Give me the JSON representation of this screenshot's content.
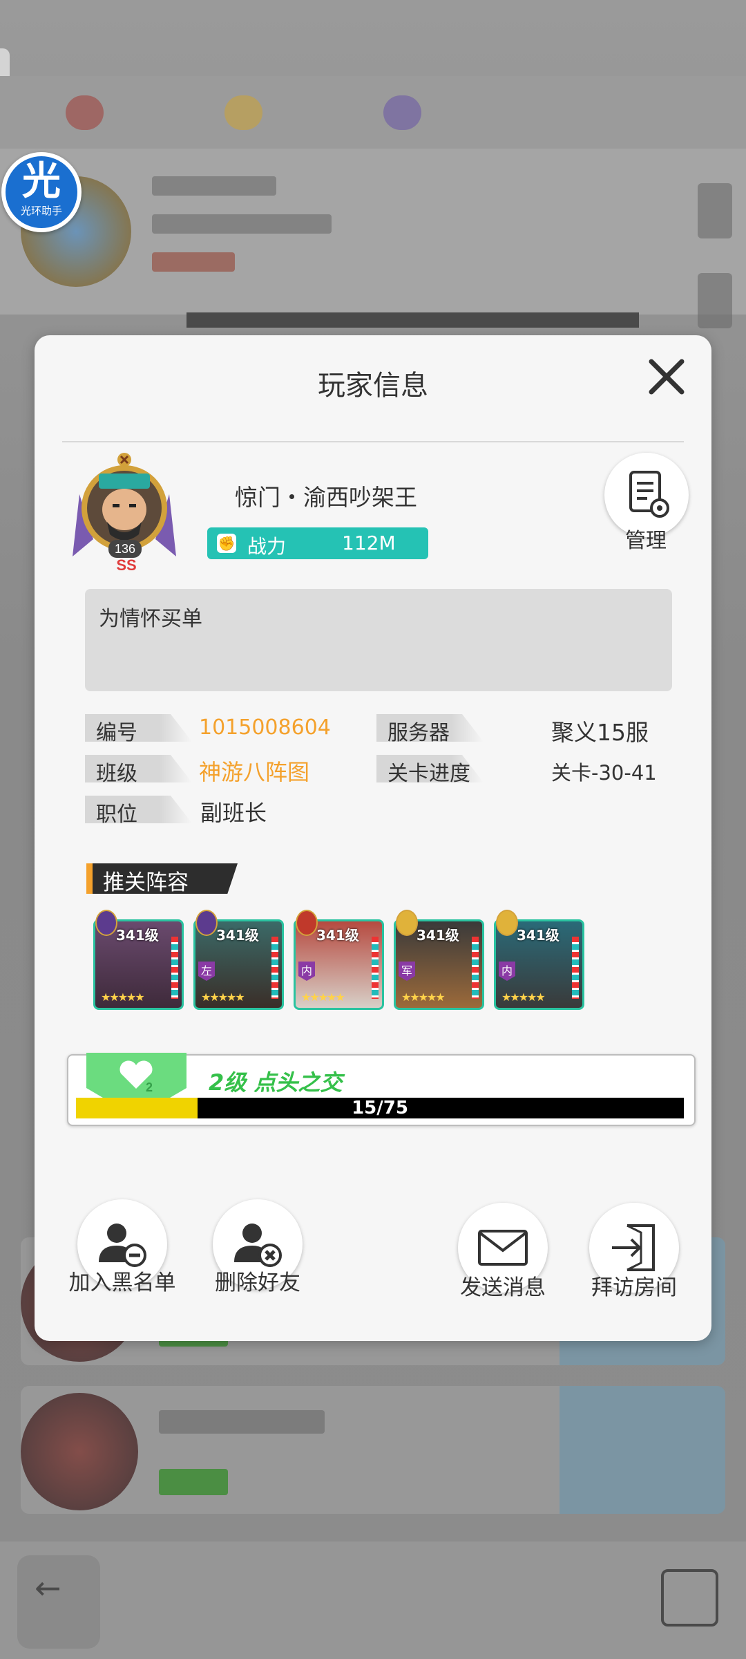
{
  "helper_badge": {
    "char": "光",
    "label": "光环助手"
  },
  "dialog": {
    "title": "玩家信息",
    "player": {
      "name": "惊门・渝西吵架王",
      "level": "136",
      "power_label": "战力",
      "power_value": "112M",
      "signature": "为情怀买单"
    },
    "manage_label": "管理",
    "info": {
      "id_label": "编号",
      "id_value": "1015008604",
      "server_label": "服务器",
      "server_value": "聚义15服",
      "class_label": "班级",
      "class_value": "神游八阵图",
      "stage_label": "关卡进度",
      "stage_value": "关卡-30-41",
      "position_label": "职位",
      "position_value": "副班长"
    },
    "lineup": {
      "title": "推关阵容",
      "heroes": [
        {
          "level": "341级",
          "tag": ""
        },
        {
          "level": "341级",
          "tag": "左"
        },
        {
          "level": "341级",
          "tag": "内"
        },
        {
          "level": "341级",
          "tag": "军"
        },
        {
          "level": "341级",
          "tag": "内"
        }
      ]
    },
    "friendship": {
      "heart_level": "2",
      "level_text": "2级 点头之交",
      "progress_text": "15/75",
      "progress_fraction": 0.2
    },
    "actions": {
      "blacklist": "加入黑名单",
      "delete_friend": "删除好友",
      "send_message": "发送消息",
      "visit_room": "拜访房间"
    }
  }
}
